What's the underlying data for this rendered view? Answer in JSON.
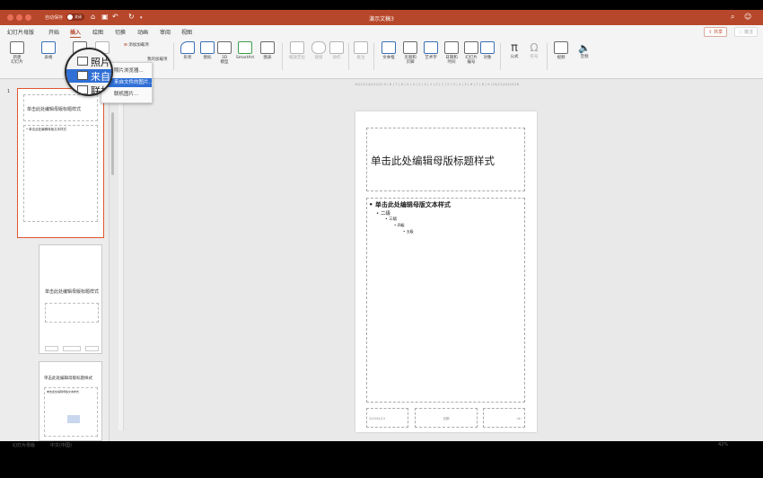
{
  "titlebar": {
    "autosave_label": "自动保存",
    "autosave_state": "关闭",
    "document_title": "演示文稿3"
  },
  "tabs": [
    {
      "label": "幻灯片母版",
      "active": false
    },
    {
      "label": "开始",
      "active": false
    },
    {
      "label": "插入",
      "active": true
    },
    {
      "label": "绘图",
      "active": false
    },
    {
      "label": "切换",
      "active": false
    },
    {
      "label": "动画",
      "active": false
    },
    {
      "label": "审阅",
      "active": false
    },
    {
      "label": "视图",
      "active": false
    }
  ],
  "header_actions": {
    "share": "共享",
    "comment": "批注"
  },
  "ribbon": {
    "new_slide": "新建\n幻灯片",
    "table": "表格",
    "album_a": "添加加载项",
    "album_b": "我的加载项",
    "shapes": "形状",
    "icons": "图标",
    "model3d": "3D\n模型",
    "smartart": "SmartArt",
    "chart": "图表",
    "zoom": "缩放定位",
    "link": "链接",
    "action": "动作",
    "comment": "批注",
    "textbox": "文本框",
    "header_footer": "页眉和\n页脚",
    "wordart": "艺术字",
    "datetime": "日期和\n时间",
    "slide_number": "幻灯片\n编号",
    "object": "对象",
    "equation": "公式",
    "symbol": "符号",
    "video": "视频",
    "audio": "音频"
  },
  "picture_menu": {
    "magnified": [
      "照片",
      "来自文",
      "联机"
    ],
    "items": [
      "照片浏览器...",
      "来自文件的图片...",
      "联机图片..."
    ],
    "highlighted_index": 1
  },
  "thumbnails": {
    "first_number": "1",
    "master_title": "单击此处编辑母版标题样式",
    "master_body": "• 单击此处编辑母版文本样式",
    "layout2_title": "单击此处编辑母版标题样式",
    "layout3_title": "单击此处编辑母版标题样式",
    "layout3_body": "单击此处编辑母版文本样式"
  },
  "slide": {
    "title": "单击此处编辑母版标题样式",
    "body_levels": [
      "• 单击此处编辑母版文本样式",
      "• 二级",
      "• 三级",
      "• 四级",
      "• 五级"
    ],
    "footer_date": "2020/5/13",
    "footer_center": "页脚",
    "footer_num": "‹#›"
  },
  "ruler": "10|12|14|12|10| 9 | 8 | 7 | 6 | 5 | 4 | 3 | 2 | 1 | 0 | 1 | 2 | 3 | 4 | 5 | 6 | 7 | 8 | 9 |10|12|14|12|16",
  "statusbar": {
    "left": "幻灯片母版",
    "lang": "中文(中国)",
    "zoom": "42%"
  },
  "colors": {
    "accent": "#b7472a",
    "highlight": "#2f6fd6"
  }
}
